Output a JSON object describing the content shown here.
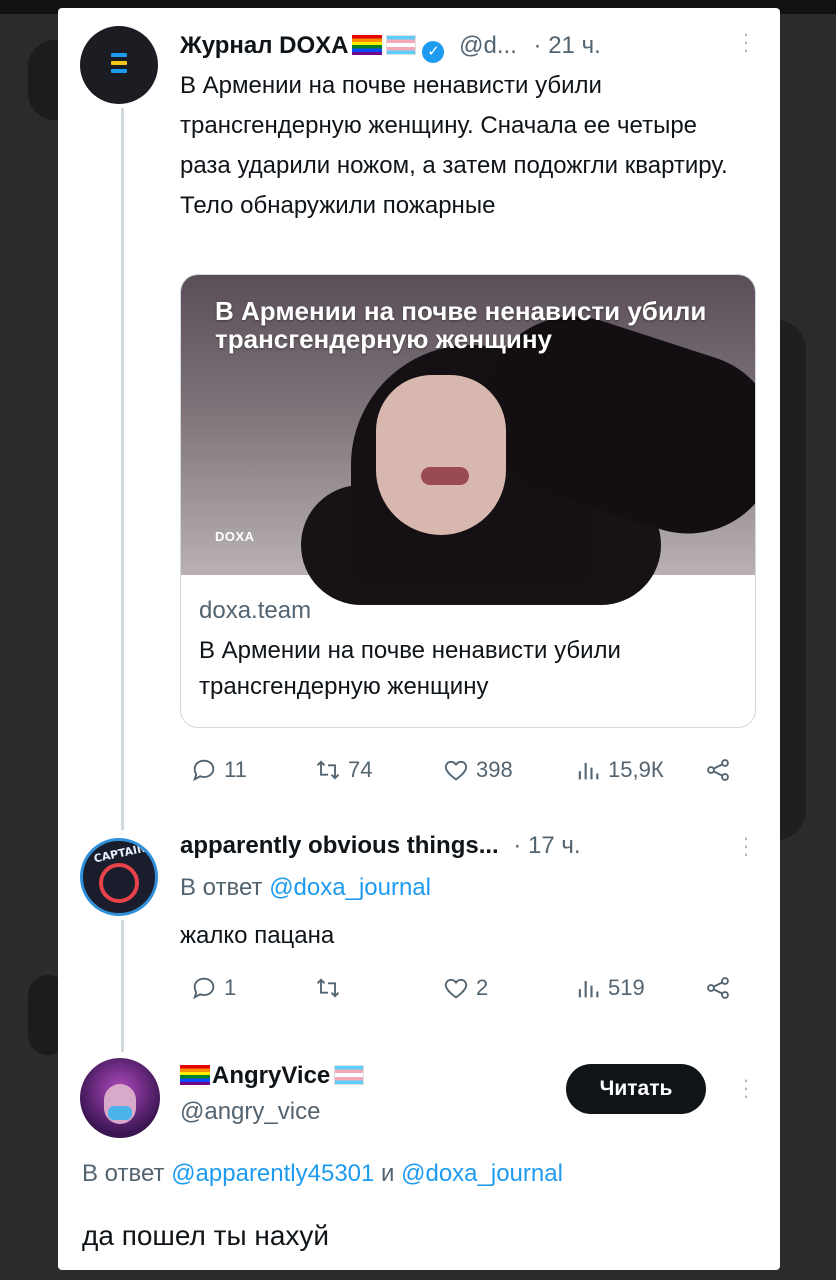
{
  "tweet1": {
    "author": "Журнал DOXA",
    "handle": "@d...",
    "time": "· 21 ч.",
    "text": "В Армении на почве ненависти убили трансгендерную женщину. Сначала ее четыре раза ударили ножом, а затем подожгли квартиру. Тело обнаружили пожарные",
    "card": {
      "image_headline": "В Армении на почве ненависти убили трансгендерную женщину",
      "image_logo": "DOXA",
      "domain": "doxa.team",
      "title": "В Армении на почве ненависти убили трансгендерную женщину"
    },
    "stats": {
      "replies": "11",
      "retweets": "74",
      "likes": "398",
      "views": "15,9К"
    }
  },
  "tweet2": {
    "author": "apparently obvious things...",
    "time": "· 17 ч.",
    "avatar_text": "CAPTAIN",
    "reply_label": "В ответ",
    "reply_mention": "@doxa_journal",
    "text": "жалко пацана",
    "stats": {
      "replies": "1",
      "retweets": "",
      "likes": "2",
      "views": "519"
    }
  },
  "tweet3": {
    "author": "AngryVice",
    "handle": "@angry_vice",
    "follow_label": "Читать",
    "reply_label": "В ответ",
    "reply_mention1": "@apparently45301",
    "reply_and": "и",
    "reply_mention2": "@doxa_journal",
    "text": "да пошел ты нахуй"
  },
  "colors": {
    "accent": "#1d9bf0",
    "muted": "#536471",
    "text": "#0f1419",
    "flag_doxa": [
      "#1d9bf0",
      "#f5c518"
    ]
  },
  "icons": [
    "reply-icon",
    "retweet-icon",
    "like-icon",
    "views-icon",
    "share-icon",
    "more-icon",
    "verified-icon"
  ]
}
